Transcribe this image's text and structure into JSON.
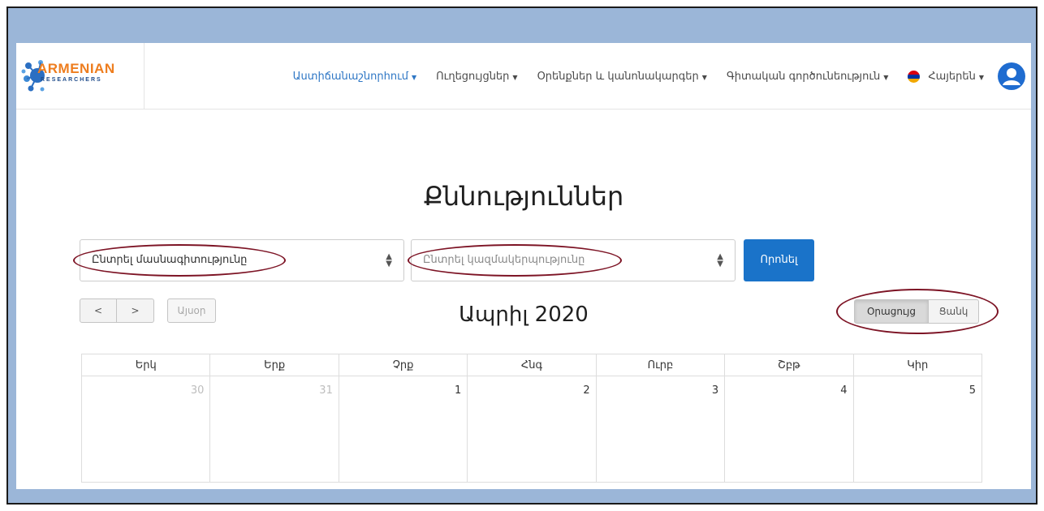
{
  "brand": {
    "name": "ARMENIAN",
    "subtitle": "RESEARCHERS"
  },
  "nav": {
    "items": [
      {
        "label": "Աստիճանաշնորհում",
        "active": true
      },
      {
        "label": "Ուղեցույցներ",
        "active": false
      },
      {
        "label": "Օրենքներ և կանոնակարգեր",
        "active": false
      },
      {
        "label": "Գիտական գործունեություն",
        "active": false
      }
    ],
    "language": "Հայերեն"
  },
  "page": {
    "title": "Քննություններ"
  },
  "filters": {
    "specialty": "Ընտրել մասնագիտությունը",
    "organization_placeholder": "Ընտրել կազմակերպությունը",
    "search_button": "Որոնել"
  },
  "calendar": {
    "prev": "<",
    "next": ">",
    "today": "Այսօր",
    "title": "Ապրիլ 2020",
    "views": {
      "calendar": "Օրացույց",
      "list": "Ցանկ",
      "active": "calendar"
    },
    "weekdays": [
      "Երկ",
      "Երք",
      "Չրք",
      "Հնգ",
      "Ուրբ",
      "Շբթ",
      "Կիր"
    ],
    "week1": [
      {
        "day": "30",
        "other": true
      },
      {
        "day": "31",
        "other": true
      },
      {
        "day": "1",
        "other": false
      },
      {
        "day": "2",
        "other": false
      },
      {
        "day": "3",
        "other": false
      },
      {
        "day": "4",
        "other": false
      },
      {
        "day": "5",
        "other": false
      }
    ]
  },
  "colors": {
    "accent": "#2f77c5",
    "button_primary": "#1a73c9",
    "annotation": "#7d1425",
    "frame_background": "#9bb6d8",
    "brand_orange": "#ee7d1e"
  }
}
